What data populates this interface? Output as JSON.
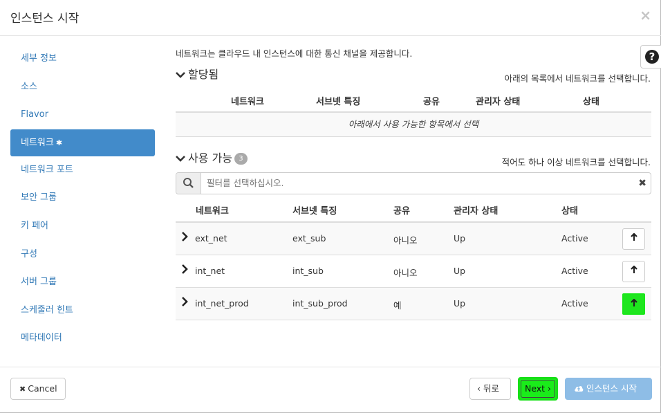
{
  "dialog": {
    "title": "인스턴스 시작",
    "close_icon": "×"
  },
  "sidebar": {
    "items": [
      {
        "label": "세부 정보"
      },
      {
        "label": "소스"
      },
      {
        "label": "Flavor"
      },
      {
        "label": "네트워크",
        "required_mark": "✱"
      },
      {
        "label": "네트워크 포트"
      },
      {
        "label": "보안 그룹"
      },
      {
        "label": "키 페어"
      },
      {
        "label": "구성"
      },
      {
        "label": "서버 그룹"
      },
      {
        "label": "스케줄러 힌트"
      },
      {
        "label": "메타데이터"
      }
    ]
  },
  "main": {
    "description": "네트워크는 클라우드 내 인스턴스에 대한 통신 채널을 제공합니다.",
    "help_icon": "?",
    "allocated": {
      "chevron_icon": "chevron-down-icon",
      "title": "할당됨",
      "help": "아래의 목록에서 네트워크를 선택합니다.",
      "columns": [
        "네트워크",
        "서브넷 특징",
        "공유",
        "관리자 상태",
        "상태"
      ],
      "empty_text": "아래에서 사용 가능한 항목에서 선택"
    },
    "available": {
      "chevron_icon": "chevron-down-icon",
      "title": "사용 가능",
      "count": "3",
      "help": "적어도 하나 이상 네트워크를 선택합니다.",
      "filter_placeholder": "필터를 선택하십시오.",
      "filter_clear": "✖",
      "columns": [
        "네트워크",
        "서브넷 특징",
        "공유",
        "관리자 상태",
        "상태"
      ],
      "rows": [
        {
          "network": "ext_net",
          "subnet": "ext_sub",
          "shared": "아니오",
          "admin_state": "Up",
          "status": "Active"
        },
        {
          "network": "int_net",
          "subnet": "int_sub",
          "shared": "아니오",
          "admin_state": "Up",
          "status": "Active"
        },
        {
          "network": "int_net_prod",
          "subnet": "int_sub_prod",
          "shared": "예",
          "admin_state": "Up",
          "status": "Active"
        }
      ]
    }
  },
  "footer": {
    "cancel_label": "Cancel",
    "cancel_icon": "✖",
    "back_label": "‹ 뒤로",
    "next_label": "Next ›",
    "launch_label": "인스턴스 시작"
  },
  "colors": {
    "accent": "#428bca",
    "link": "#337ab7",
    "highlight": "#1ee61e",
    "launch_disabled": "#8ebde6"
  }
}
